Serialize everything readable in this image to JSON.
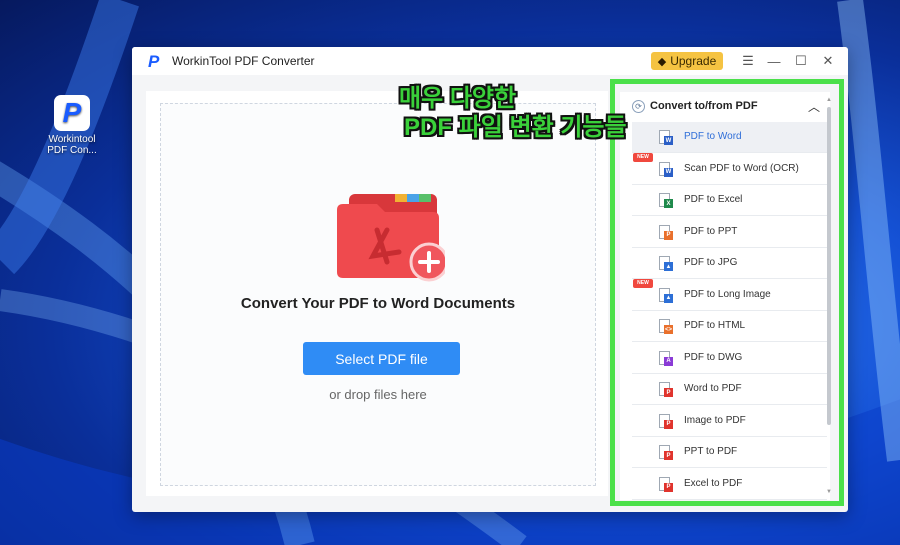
{
  "desktop": {
    "icon_label_line1": "Workintool",
    "icon_label_line2": "PDF Con..."
  },
  "window": {
    "title": "WorkinTool PDF Converter",
    "upgrade_label": "Upgrade",
    "controls": {
      "menu": "☰",
      "minimize": "—",
      "maximize": "☐",
      "close": "✕"
    }
  },
  "dropzone": {
    "title": "Convert Your PDF to Word Documents",
    "button_label": "Select PDF file",
    "hint": "or drop files here"
  },
  "side": {
    "header": "Convert to/from PDF",
    "new_badge": "NEW",
    "items": [
      {
        "label": "PDF to Word",
        "active": true,
        "new": false,
        "badge": "W",
        "color": "#2b5fc7"
      },
      {
        "label": "Scan PDF to Word (OCR)",
        "active": false,
        "new": true,
        "badge": "W",
        "color": "#2b5fc7"
      },
      {
        "label": "PDF to Excel",
        "active": false,
        "new": false,
        "badge": "X",
        "color": "#1f8a4c"
      },
      {
        "label": "PDF to PPT",
        "active": false,
        "new": false,
        "badge": "P",
        "color": "#e9702c"
      },
      {
        "label": "PDF to JPG",
        "active": false,
        "new": false,
        "badge": "▲",
        "color": "#2d6fd6"
      },
      {
        "label": "PDF to Long Image",
        "active": false,
        "new": true,
        "badge": "▲",
        "color": "#2d6fd6"
      },
      {
        "label": "PDF to HTML",
        "active": false,
        "new": false,
        "badge": "<>",
        "color": "#e9702c"
      },
      {
        "label": "PDF to DWG",
        "active": false,
        "new": false,
        "badge": "A",
        "color": "#8a3bd6"
      },
      {
        "label": "Word to PDF",
        "active": false,
        "new": false,
        "badge": "P",
        "color": "#e0342d"
      },
      {
        "label": "Image to PDF",
        "active": false,
        "new": false,
        "badge": "P",
        "color": "#e0342d"
      },
      {
        "label": "PPT to PDF",
        "active": false,
        "new": false,
        "badge": "P",
        "color": "#e0342d"
      },
      {
        "label": "Excel to PDF",
        "active": false,
        "new": false,
        "badge": "P",
        "color": "#e0342d"
      }
    ]
  },
  "overlay": {
    "line1": "매우 다양한",
    "line2": "PDF 파일 변환 기능들",
    "color": "#3ad13a"
  },
  "colors": {
    "accent": "#2f8cf5",
    "upgrade": "#f5c342",
    "highlight_frame": "#4be04a"
  }
}
